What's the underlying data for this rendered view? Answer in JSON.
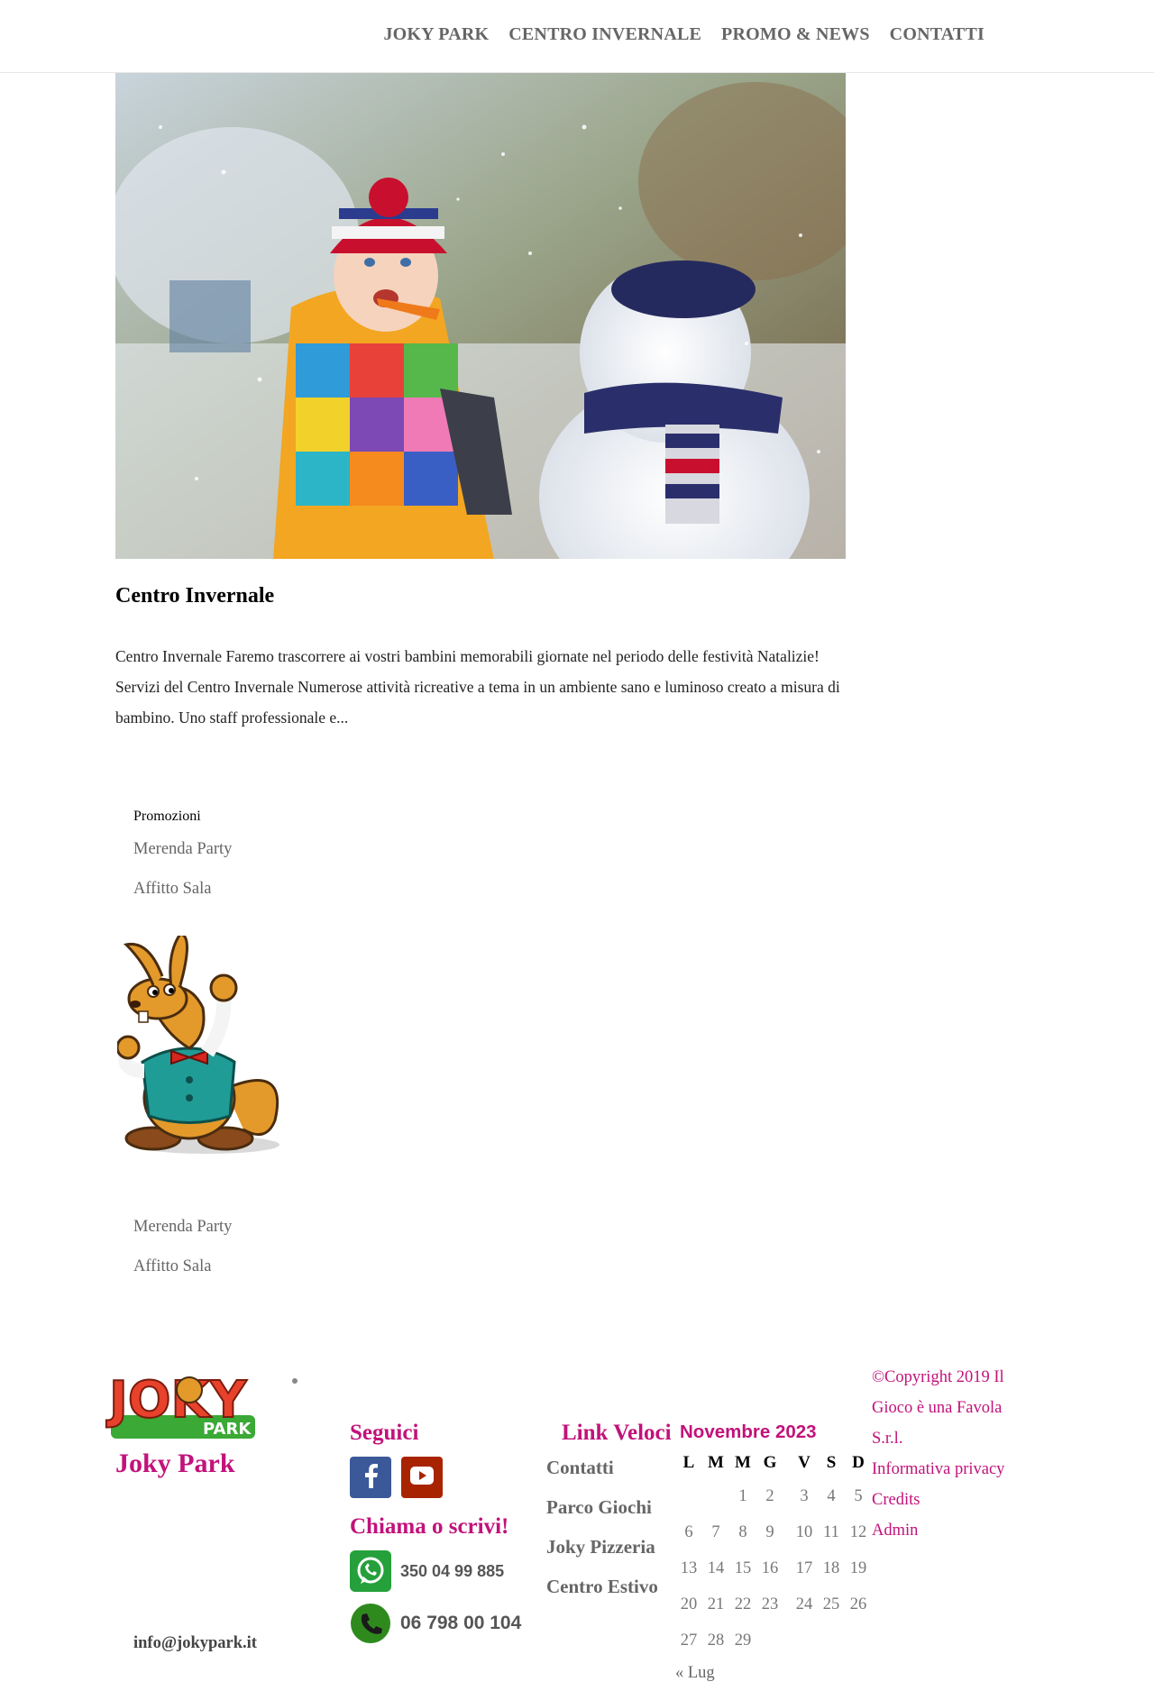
{
  "nav": {
    "items": [
      {
        "label": "JOKY PARK"
      },
      {
        "label": "CENTRO INVERNALE"
      },
      {
        "label": "PROMO & NEWS"
      },
      {
        "label": "CONTATTI"
      }
    ]
  },
  "post": {
    "title": "Centro Invernale",
    "excerpt": "Centro Invernale Faremo trascorrere ai vostri bambini memorabili giornate nel periodo delle festività Natalizie! Servizi del Centro Invernale Numerose attività ricreative a tema in un ambiente sano e luminoso creato a misura di bambino. Uno staff professionale e..."
  },
  "promo": {
    "heading": "Promozioni",
    "links": [
      "Merenda Party",
      "Affitto Sala"
    ],
    "links_bottom": [
      "Merenda Party",
      "Affitto Sala"
    ]
  },
  "footer": {
    "logo_text": "JOKY",
    "logo_sub": "PARK",
    "brand": "Joky Park",
    "email": "info@jokypark.it",
    "social_heading": "Seguici",
    "call_heading": "Chiama o scrivi!",
    "whatsapp": "350 04 99 885",
    "phone": "06 798 00 104",
    "quick_heading": "Link Veloci",
    "quick_links": [
      "Contatti",
      "Parco Giochi",
      "Joky Pizzeria",
      "Centro Estivo"
    ],
    "copyright": "©Copyright 2019 Il Gioco è una Favola S.r.l.",
    "privacy": "Informativa privacy",
    "credits": "Credits",
    "admin": "Admin"
  },
  "calendar": {
    "caption": "Novembre 2023",
    "days": [
      "L",
      "M",
      "M",
      "G",
      "V",
      "S",
      "D"
    ],
    "weeks": [
      [
        "",
        "",
        "1",
        "2",
        "3",
        "4",
        "5"
      ],
      [
        "6",
        "7",
        "8",
        "9",
        "10",
        "11",
        "12"
      ],
      [
        "13",
        "14",
        "15",
        "16",
        "17",
        "18",
        "19"
      ],
      [
        "20",
        "21",
        "22",
        "23",
        "24",
        "25",
        "26"
      ],
      [
        "27",
        "28",
        "29",
        "",
        "",
        "",
        ""
      ]
    ],
    "prev": "« Lug"
  },
  "colors": {
    "accent": "#c2127a",
    "nav_text": "#666666",
    "facebook": "#3b5998",
    "youtube": "#a82400",
    "whatsapp": "#25a03a",
    "phone": "#2f8a1e"
  }
}
